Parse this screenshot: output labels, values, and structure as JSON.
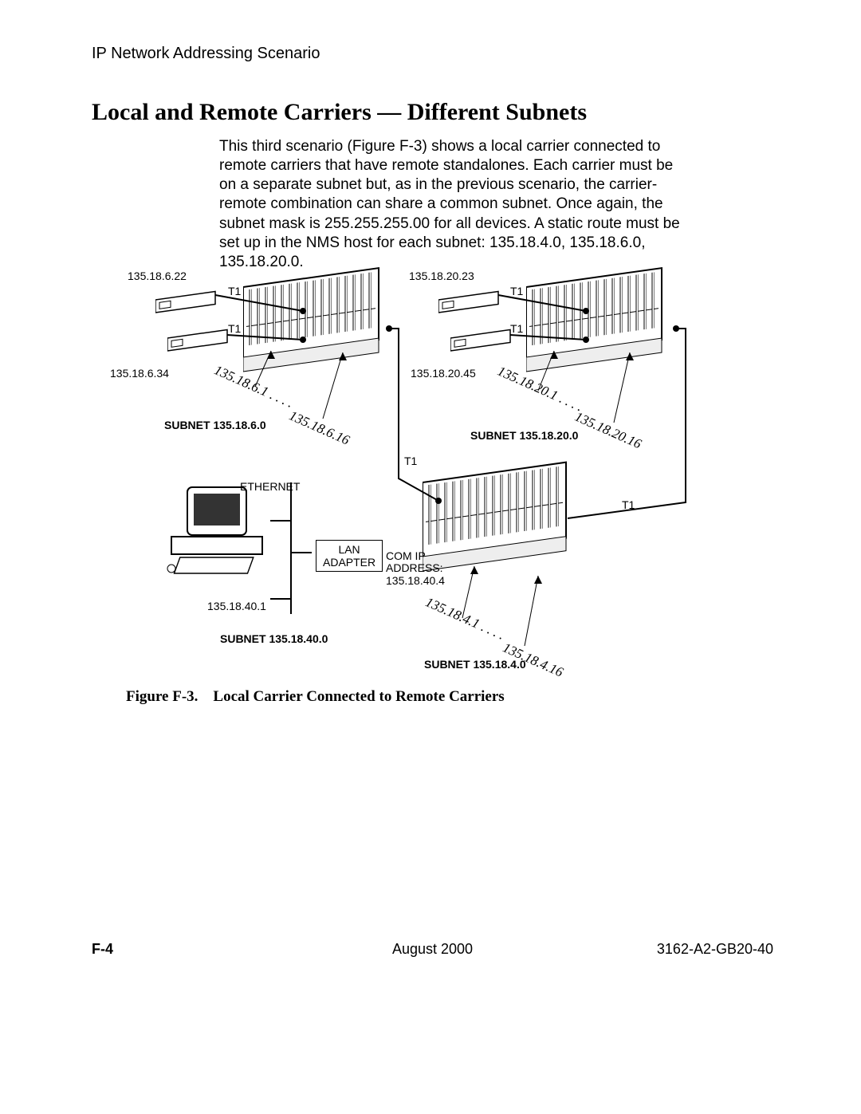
{
  "header": "IP Network Addressing Scenario",
  "title": "Local and Remote Carriers — Different Subnets",
  "body": "This third scenario (Figure F-3) shows a local carrier connected to remote carriers that have remote standalones. Each carrier must be on a separate subnet but, as in the previous scenario, the carrier-remote combination can share a common subnet. Once again, the subnet mask is 255.255.255.00 for all devices. A static route must be set up in the NMS host for each subnet: 135.18.4.0, 135.18.6.0, 135.18.20.0.",
  "labels": {
    "ip_622": "135.18.6.22",
    "ip_634": "135.18.6.34",
    "ip_2023": "135.18.20.23",
    "ip_2045": "135.18.20.45",
    "ip_401": "135.18.40.1",
    "t1": "T1",
    "ethernet": "ETHERNET",
    "lan_adapter": "LAN\nADAPTER",
    "com_ip": "COM IP\nADDRESS:\n135.18.40.4",
    "subnet_6": "SUBNET 135.18.6.0",
    "subnet_20": "SUBNET 135.18.20.0",
    "subnet_40": "SUBNET 135.18.40.0",
    "subnet_4": "SUBNET 135.18.4.0",
    "slot_6_1": "135.18.6.1 . . . .",
    "slot_6_16": "135.18.6.16",
    "slot_20_1": "135.18.20.1 . . . .",
    "slot_20_16": "135.18.20.16",
    "slot_4_1": "135.18.4.1 . . . .",
    "slot_4_16": "135.18.4.16"
  },
  "caption_prefix": "Figure F-3.",
  "caption_text": "Local Carrier Connected to Remote Carriers",
  "footer": {
    "page": "F-4",
    "date": "August 2000",
    "doc": "3162-A2-GB20-40"
  }
}
